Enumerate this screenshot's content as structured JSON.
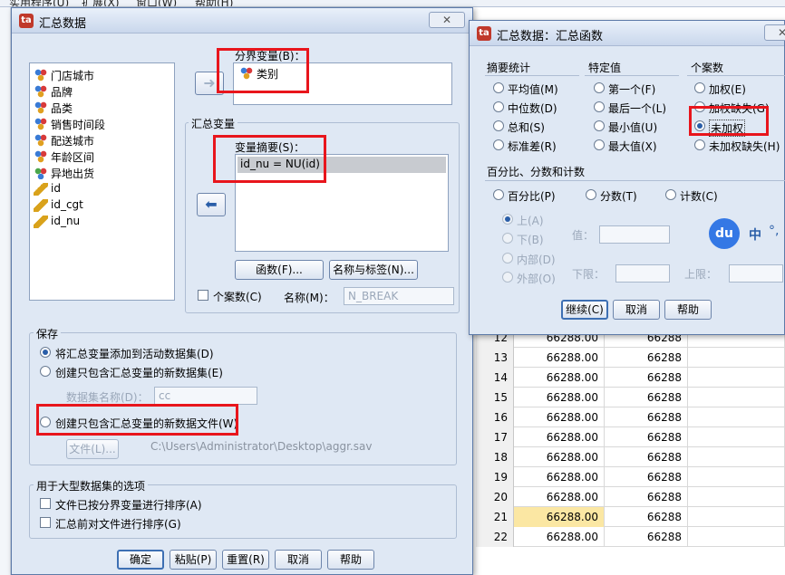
{
  "background": {
    "menu_items": [
      "实用程序(U)",
      "扩展(X)",
      "窗口(W)",
      "帮助(H)"
    ],
    "rows": [
      {
        "n": "12",
        "v1": "66288.00",
        "v2": "66288"
      },
      {
        "n": "13",
        "v1": "66288.00",
        "v2": "66288"
      },
      {
        "n": "14",
        "v1": "66288.00",
        "v2": "66288"
      },
      {
        "n": "15",
        "v1": "66288.00",
        "v2": "66288"
      },
      {
        "n": "16",
        "v1": "66288.00",
        "v2": "66288"
      },
      {
        "n": "17",
        "v1": "66288.00",
        "v2": "66288"
      },
      {
        "n": "18",
        "v1": "66288.00",
        "v2": "66288"
      },
      {
        "n": "19",
        "v1": "66288.00",
        "v2": "66288"
      },
      {
        "n": "20",
        "v1": "66288.00",
        "v2": "66288"
      },
      {
        "n": "21",
        "v1": "66288.00",
        "v2": "66288"
      },
      {
        "n": "22",
        "v1": "66288.00",
        "v2": "66288"
      }
    ]
  },
  "main_dialog": {
    "title": "汇总数据",
    "close": "✕",
    "variables": [
      {
        "label": "门店城市",
        "icon": "nominal-variable-icon"
      },
      {
        "label": "品牌",
        "icon": "nominal-variable-icon"
      },
      {
        "label": "品类",
        "icon": "nominal-variable-icon"
      },
      {
        "label": "销售时间段",
        "icon": "nominal-variable-icon"
      },
      {
        "label": "配送城市",
        "icon": "nominal-variable-icon"
      },
      {
        "label": "年龄区间",
        "icon": "nominal-variable-icon"
      },
      {
        "label": "异地出货",
        "icon": "ordinal-variable-icon"
      },
      {
        "label": "id",
        "icon": "scale-variable-icon"
      },
      {
        "label": "id_cgt",
        "icon": "scale-variable-icon"
      },
      {
        "label": "id_nu",
        "icon": "scale-variable-icon"
      }
    ],
    "break_label": "分界变量(B)：",
    "break_var": "类别",
    "aggregated_group": "汇总变量",
    "summaries_label": "变量摘要(S)：",
    "summary_item": "id_nu = NU(id)",
    "function_btn": "函数(F)...",
    "name_label_btn": "名称与标签(N)...",
    "num_cases_label": "个案数(C)",
    "name_label": "名称(M)：",
    "name_value": "N_BREAK",
    "save_group": "保存",
    "save_opt1": "将汇总变量添加到活动数据集(D)",
    "save_opt2": "创建只包含汇总变量的新数据集(E)",
    "dataset_name_label": "数据集名称(D)：",
    "dataset_name_value": "cc",
    "save_opt3": "创建只包含汇总变量的新数据文件(W)",
    "file_btn": "文件(L)...",
    "file_path": "C:\\Users\\Administrator\\Desktop\\aggr.sav",
    "large_group": "用于大型数据集的选项",
    "large_opt1": "文件已按分界变量进行排序(A)",
    "large_opt2": "汇总前对文件进行排序(G)",
    "btn_ok": "确定",
    "btn_paste": "粘贴(P)",
    "btn_reset": "重置(R)",
    "btn_cancel": "取消",
    "btn_help": "帮助"
  },
  "function_dialog": {
    "title": "汇总数据：汇总函数",
    "close": "✕",
    "col1_title": "摘要统计",
    "col2_title": "特定值",
    "col3_title": "个案数",
    "col1": [
      "平均值(M)",
      "中位数(D)",
      "总和(S)",
      "标准差(R)"
    ],
    "col2": [
      "第一个(F)",
      "最后一个(L)",
      "最小值(U)",
      "最大值(X)"
    ],
    "col3": [
      "加权(E)",
      "加权缺失(G)",
      "未加权",
      "未加权缺失(H)"
    ],
    "pct_title": "百分比、分数和计数",
    "pct_opts": [
      "百分比(P)",
      "分数(T)",
      "计数(C)"
    ],
    "sub_opts": [
      "上(A)",
      "下(B)",
      "内部(D)",
      "外部(O)"
    ],
    "value_label": "值：",
    "low_label": "下限：",
    "high_label": "上限：",
    "btn_continue": "继续(C)",
    "btn_cancel": "取消",
    "btn_help": "帮助",
    "ime_text": "中",
    "ime_extra": "°,",
    "ime_logo": "du"
  }
}
